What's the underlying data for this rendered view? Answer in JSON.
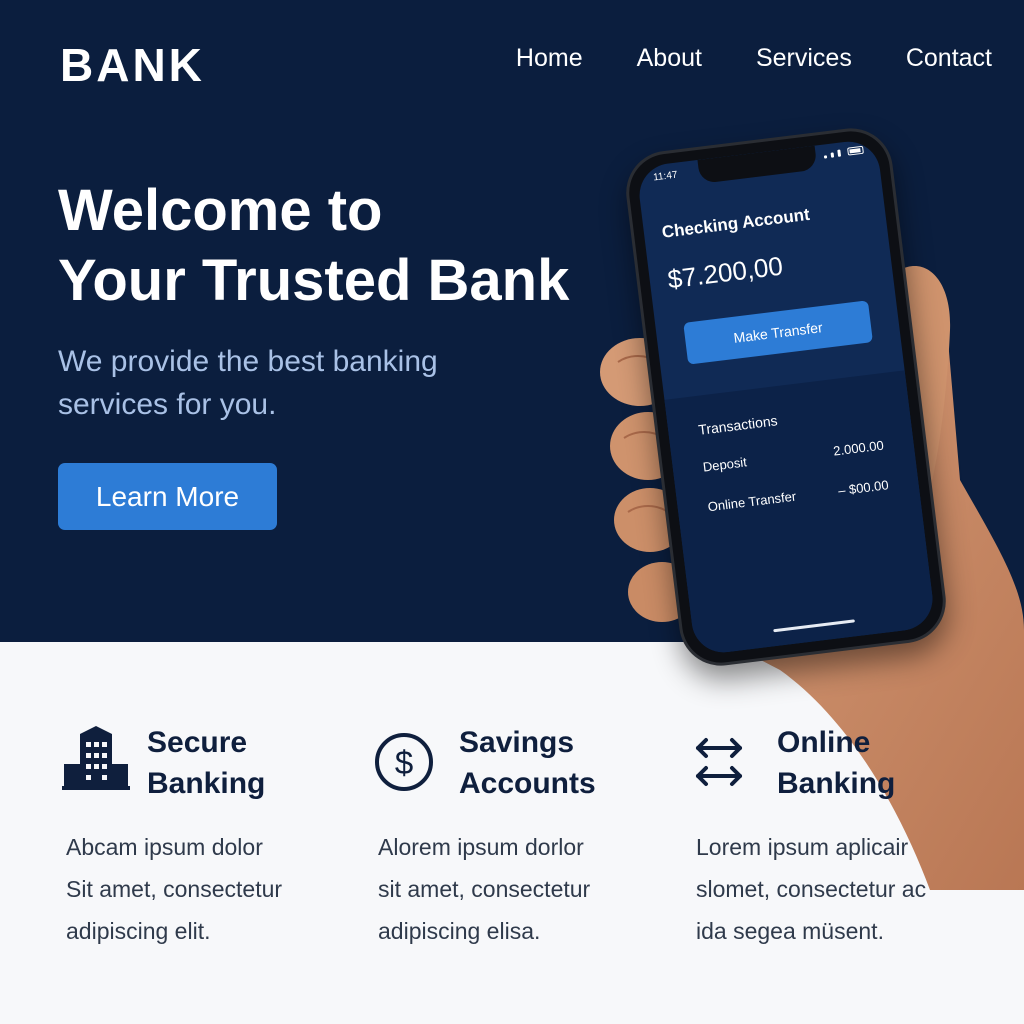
{
  "header": {
    "logo": "BANK",
    "nav": [
      "Home",
      "About",
      "Services",
      "Contact"
    ]
  },
  "hero": {
    "title_lines": [
      "Welcome to",
      "Your Trusted Bank"
    ],
    "subtitle_lines": [
      "We provide the best banking",
      "services for you."
    ],
    "cta_label": "Learn More"
  },
  "phone": {
    "time": "11:47",
    "account_title": "Checking Account",
    "balance": "$7.200,00",
    "transfer_label": "Make Transfer",
    "transactions_title": "Transactions",
    "transactions": [
      {
        "label": "Deposit",
        "amount": "2.000.00"
      },
      {
        "label": "Online Transfer",
        "amount": "– $00.00"
      }
    ]
  },
  "features": [
    {
      "icon": "building-icon",
      "title_lines": [
        "Secure",
        "Banking"
      ],
      "desc_lines": [
        "Abcam ipsum dolor",
        "Sit amet, consectetur",
        "adipiscing elit."
      ]
    },
    {
      "icon": "dollar-circle-icon",
      "title_lines": [
        "Savings",
        "Accounts"
      ],
      "desc_lines": [
        "Alorem ipsum dorlor",
        "sit amet, consectetur",
        "adipiscing elisa."
      ]
    },
    {
      "icon": "transfer-arrows-icon",
      "title_lines": [
        "Online",
        "Banking"
      ],
      "desc_lines": [
        "Lorem ipsum aplicair",
        "slomet, consectetur ac",
        "ida segea müsent."
      ]
    }
  ],
  "colors": {
    "hero_bg": "#0b1e3e",
    "accent": "#2d7cd6",
    "subtitle": "#a9c1e6",
    "heading_dark": "#0f1f3d"
  }
}
